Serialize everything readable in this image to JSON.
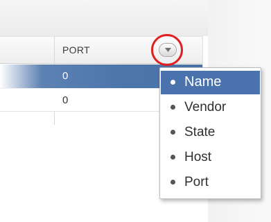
{
  "table": {
    "column_header": "PORT",
    "rows": [
      {
        "port": "0",
        "selected": true
      },
      {
        "port": "0",
        "selected": false
      }
    ]
  },
  "header_dropdown": {
    "icon": "chevron-down-icon",
    "highlight_color": "#e02020"
  },
  "column_menu": {
    "items": [
      {
        "label": "Name",
        "selected": true
      },
      {
        "label": "Vendor",
        "selected": false
      },
      {
        "label": "State",
        "selected": false
      },
      {
        "label": "Host",
        "selected": false
      },
      {
        "label": "Port",
        "selected": false
      }
    ]
  },
  "colors": {
    "selection": "#4a72ad",
    "highlight_ring": "#e02020"
  }
}
